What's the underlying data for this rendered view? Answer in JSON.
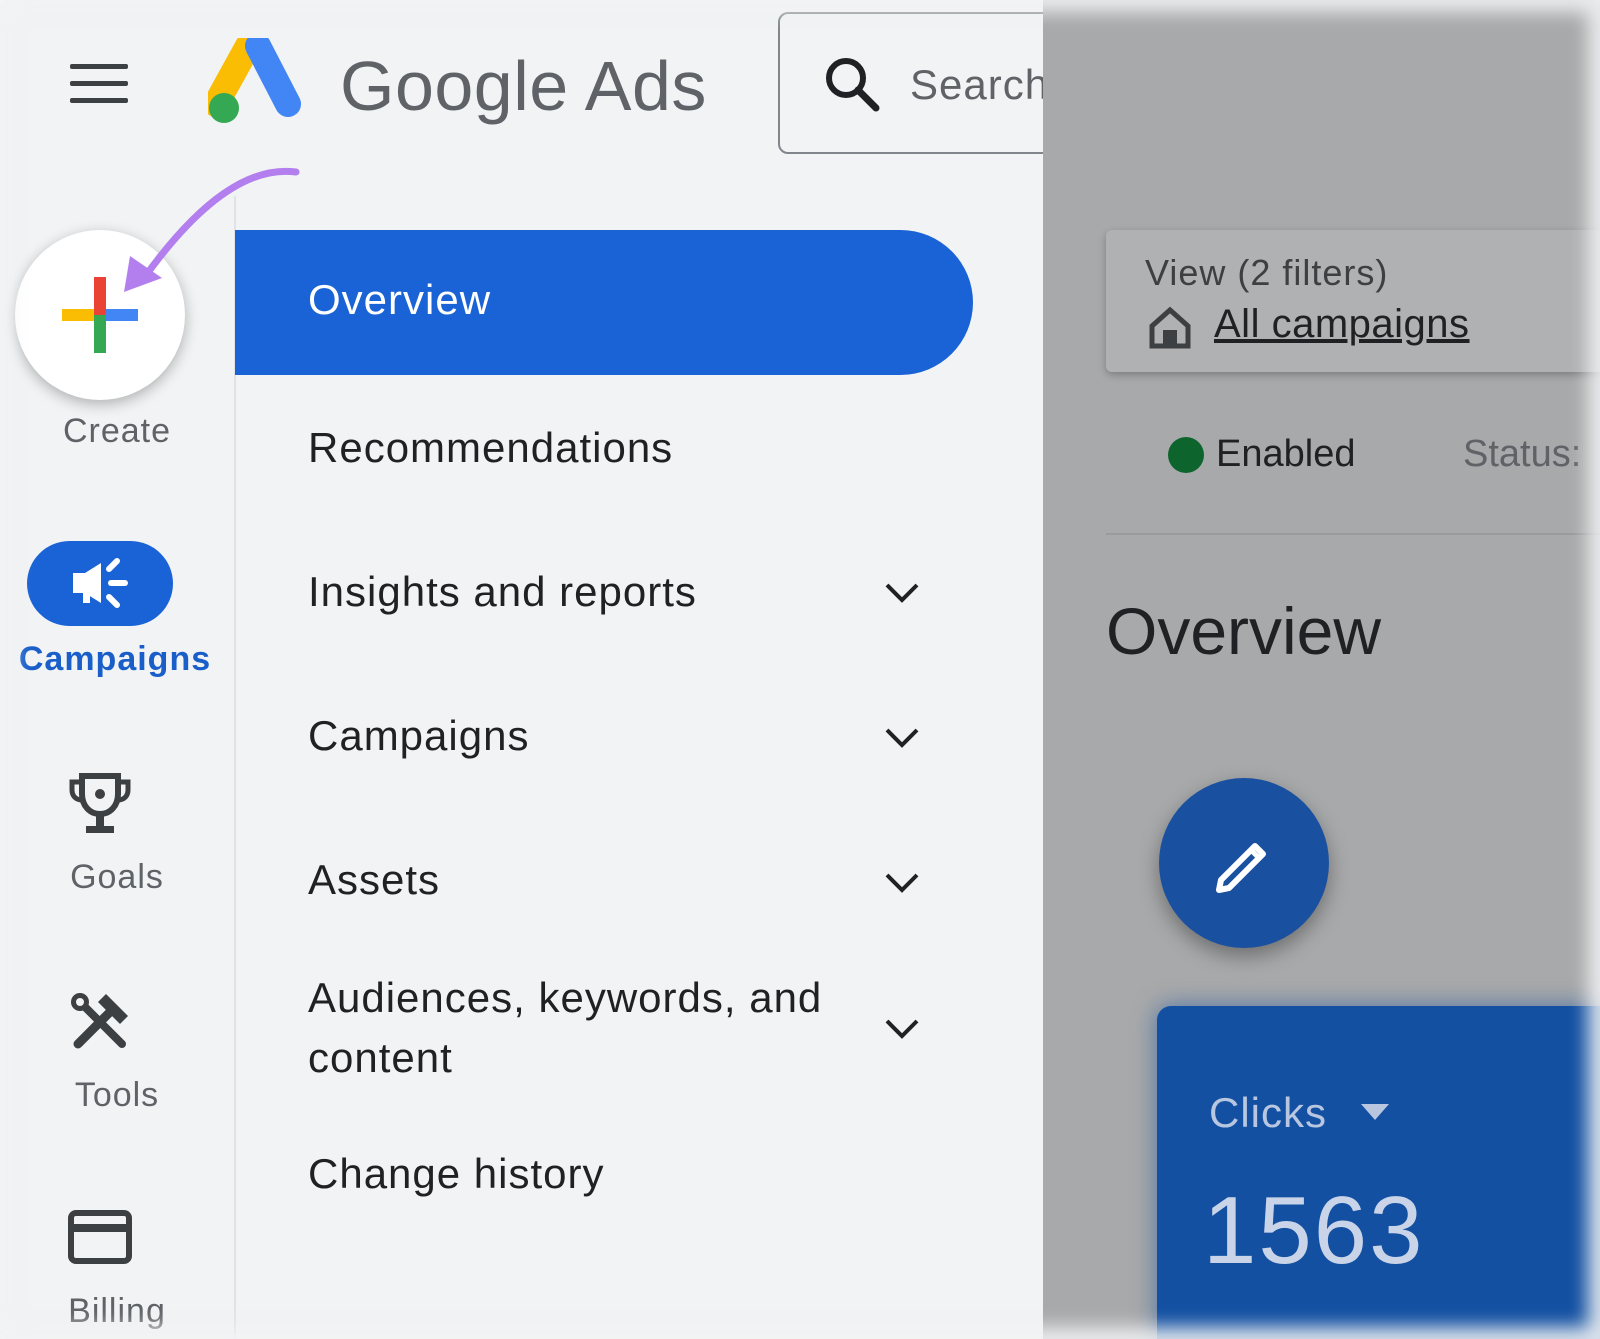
{
  "header": {
    "menu_icon": "menu-icon",
    "logo_text": "Google Ads",
    "search_placeholder": "Search for a page or campaign"
  },
  "rail": {
    "create_label": "Create",
    "items": [
      {
        "label": "Campaigns",
        "icon": "megaphone-icon",
        "active": true
      },
      {
        "label": "Goals",
        "icon": "trophy-icon",
        "active": false
      },
      {
        "label": "Tools",
        "icon": "tools-icon",
        "active": false
      },
      {
        "label": "Billing",
        "icon": "credit-card-icon",
        "active": false
      }
    ]
  },
  "nav": {
    "items": [
      {
        "label": "Overview",
        "active": true
      },
      {
        "label": "Recommendations"
      },
      {
        "label": "Insights and reports",
        "expandable": true
      },
      {
        "label": "Campaigns",
        "expandable": true
      },
      {
        "label": "Assets",
        "expandable": true
      },
      {
        "label_line1": "Audiences, keywords, and",
        "label_line2": "content",
        "expandable": true
      },
      {
        "label": "Change history"
      }
    ]
  },
  "main": {
    "view_title": "View (2 filters)",
    "view_link": "All campaigns",
    "enabled_label": "Enabled",
    "status_label": "Status:",
    "heading": "Overview",
    "metric_label": "Clicks",
    "metric_value": "1563"
  },
  "colors": {
    "accent": "#1a63d6",
    "enabled_dot": "#0d652d",
    "annotation_arrow": "#b37fee"
  }
}
